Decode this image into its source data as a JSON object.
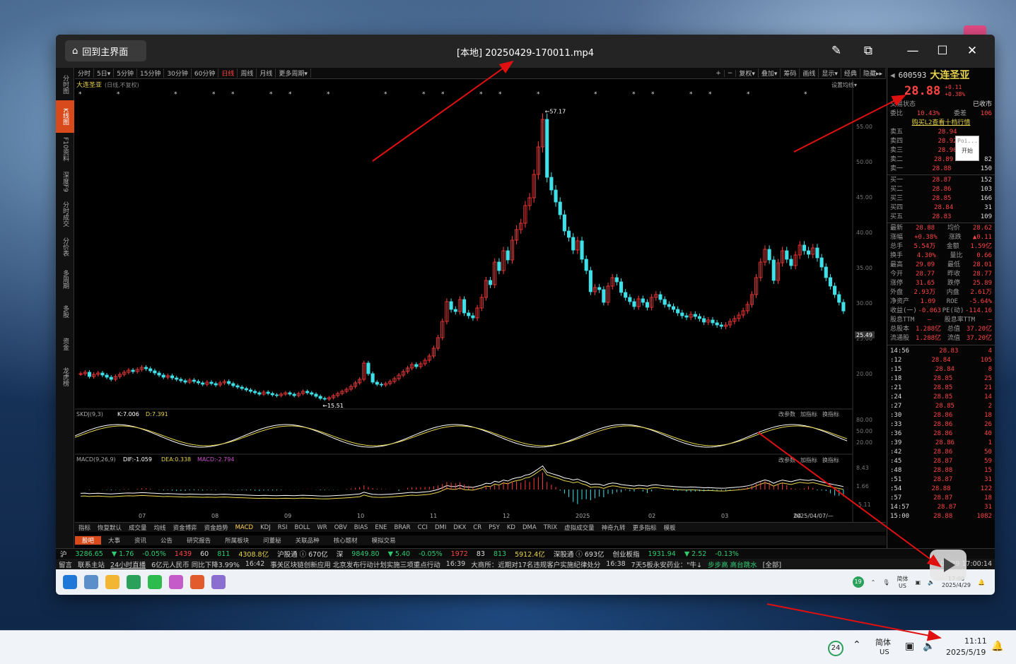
{
  "window": {
    "home_label": "回到主界面",
    "title": "[本地] 20250429-170011.mp4"
  },
  "period_tabs": [
    "分时",
    "5日▾",
    "5分钟",
    "15分钟",
    "30分钟",
    "60分钟",
    "日线",
    "周线",
    "月线",
    "更多周期▾"
  ],
  "period_active": "日线",
  "toolbar_right": [
    "+",
    "−",
    "复权▾",
    "叠加▾",
    "筹码",
    "画线",
    "显示▾",
    "经典",
    "隐藏▸▸"
  ],
  "left_tabs": [
    "分时图",
    "K线图",
    "F10资料",
    "深度F9",
    "分时成交",
    "分价表",
    "多周期",
    "多股",
    "资金",
    "龙虎榜"
  ],
  "chart_header": {
    "name": "大连圣亚",
    "mode": "(日线,不复权)",
    "right": "设置均线▾"
  },
  "chart_data": {
    "type": "candlestick",
    "price_axis": [
      "55.00",
      "50.00",
      "45.00",
      "40.00",
      "35.00",
      "30.00",
      "25.00",
      "20.00"
    ],
    "last_price_label": "25.49",
    "ylim": [
      15,
      58
    ],
    "high_label": "57.17",
    "low_label": "15.51",
    "x_ticks": [
      "07",
      "08",
      "09",
      "10",
      "11",
      "12",
      "2025",
      "02",
      "03",
      "04"
    ],
    "date_label": "2025/04/07/—",
    "closes": [
      20.0,
      20.2,
      19.6,
      19.9,
      20.1,
      19.8,
      19.5,
      19.2,
      19.6,
      19.9,
      20.2,
      20.5,
      20.3,
      20.6,
      20.9,
      20.7,
      20.4,
      20.1,
      19.8,
      19.5,
      19.7,
      19.4,
      19.2,
      19.0,
      18.8,
      19.1,
      18.9,
      18.7,
      18.5,
      18.8,
      18.6,
      18.4,
      18.7,
      18.9,
      18.6,
      18.3,
      18.1,
      17.9,
      17.7,
      17.5,
      17.3,
      17.1,
      17.4,
      17.2,
      17.0,
      16.9,
      17.1,
      17.3,
      17.1,
      16.9,
      17.2,
      17.5,
      17.3,
      17.1,
      16.8,
      16.5,
      16.4,
      16.6,
      16.9,
      17.2,
      17.5,
      17.8,
      18.2,
      18.7,
      19.2,
      21.5,
      20.0,
      18.8,
      18.5,
      18.4,
      18.6,
      18.9,
      19.3,
      19.8,
      20.3,
      20.8,
      21.3,
      21.0,
      21.4,
      21.9,
      22.5,
      23.6,
      25.1,
      27.4,
      30.2,
      29.1,
      28.8,
      30.5,
      28.6,
      28.2,
      27.9,
      29.3,
      30.8,
      33.2,
      32.6,
      35.8,
      34.6,
      37.4,
      36.1,
      38.9,
      40.4,
      41.3,
      43.8,
      44.9,
      48.2,
      52.1,
      56.0,
      47.8,
      46.0,
      44.3,
      42.5,
      40.2,
      39.3,
      37.5,
      38.8,
      36.2,
      34.6,
      31.6,
      32.2,
      31.9,
      30.1,
      32.4,
      33.6,
      33.0,
      31.5,
      30.8,
      30.2,
      29.5,
      30.6,
      30.1,
      29.4,
      30.8,
      31.2,
      30.5,
      29.8,
      29.5,
      29.1,
      28.6,
      28.2,
      28.0,
      28.4,
      28.1,
      27.8,
      27.3,
      27.6,
      27.2,
      26.9,
      26.7,
      26.9,
      27.4,
      27.8,
      28.3,
      28.9,
      29.8,
      31.2,
      33.6,
      35.8,
      37.6,
      36.1,
      33.2,
      35.7,
      37.4,
      36.2,
      35.3,
      36.8,
      38.2,
      37.4,
      36.9,
      37.8,
      36.4,
      35.1,
      33.6,
      32.4,
      31.2,
      30.1,
      28.88
    ],
    "kdj": {
      "label": "SKDJ(9,3)",
      "k": "K:7.006",
      "d": "D:7.391",
      "axis": [
        "80.00",
        "50.00",
        "20.00"
      ]
    },
    "macd": {
      "label": "MACD(9,26,9)",
      "dif": "DIF:-1.059",
      "dea": "DEA:0.338",
      "macd": "MACD:-2.794",
      "axis": [
        "8.43",
        "1.66",
        "-5.11"
      ]
    },
    "panel_buttons": [
      "改参数",
      "加指标",
      "换指标"
    ]
  },
  "indicator_tabs": [
    "指标",
    "恢复默认",
    "成交量",
    "均线",
    "资金博弈",
    "资金趋势",
    "MACD",
    "KDJ",
    "RSI",
    "BOLL",
    "WR",
    "OBV",
    "BIAS",
    "ENE",
    "BRAR",
    "CCI",
    "DMI",
    "DKX",
    "CR",
    "PSY",
    "KD",
    "DMA",
    "TRIX",
    "虚拟成交量",
    "神奇九转",
    "更多指标",
    "模板"
  ],
  "indicator_active": "MACD",
  "bottom_tabs": [
    "股吧",
    "大事",
    "资讯",
    "公告",
    "研究报告",
    "所属板块",
    "问董秘",
    "关联品种",
    "核心题材",
    "模拟交易"
  ],
  "quote": {
    "code": "600593",
    "name": "大连圣亚",
    "price": "28.88",
    "chg": "+0.11",
    "pct": "+0.38%",
    "status_label": "交易状态",
    "status": "已收市",
    "wb_label": "委比",
    "wb": "10.43%",
    "wc_label": "委差",
    "wc": "106",
    "link": "购买L2查看十档行情",
    "sells": [
      [
        "卖五",
        "28.94",
        ""
      ],
      [
        "卖四",
        "28.92",
        ""
      ],
      [
        "卖三",
        "28.90",
        ""
      ],
      [
        "卖二",
        "28.89",
        "82"
      ],
      [
        "卖一",
        "28.88",
        "150"
      ]
    ],
    "buys": [
      [
        "买一",
        "28.87",
        "152"
      ],
      [
        "买二",
        "28.86",
        "103"
      ],
      [
        "买三",
        "28.85",
        "166"
      ],
      [
        "买四",
        "28.84",
        "31"
      ],
      [
        "买五",
        "28.83",
        "109"
      ]
    ],
    "stats": [
      [
        "最新",
        "28.88",
        "均价",
        "28.62"
      ],
      [
        "涨幅",
        "+0.38%",
        "涨跌",
        "▲0.11"
      ],
      [
        "总手",
        "5.54万",
        "金额",
        "1.59亿"
      ],
      [
        "换手",
        "4.30%",
        "量比",
        "0.66"
      ],
      [
        "最高",
        "29.09",
        "最低",
        "28.01"
      ],
      [
        "今开",
        "28.77",
        "昨收",
        "28.77"
      ],
      [
        "涨停",
        "31.65",
        "跌停",
        "25.89"
      ],
      [
        "外盘",
        "2.93万",
        "内盘",
        "2.61万"
      ],
      [
        "净资产",
        "1.09",
        "ROE",
        "-5.64%"
      ],
      [
        "收益(一)",
        "-0.063",
        "PE(动)",
        "-114.16"
      ],
      [
        "股息TTM",
        "—",
        "股息率TTM",
        "—"
      ],
      [
        "总股本",
        "1.288亿",
        "总值",
        "37.20亿"
      ],
      [
        "流通股",
        "1.288亿",
        "流值",
        "37.20亿"
      ]
    ],
    "ticks": [
      [
        "14:56",
        "28.83",
        "4"
      ],
      [
        ":12",
        "28.84",
        "105"
      ],
      [
        ":15",
        "28.84",
        "8"
      ],
      [
        ":18",
        "28.85",
        "25"
      ],
      [
        ":21",
        "28.85",
        "21"
      ],
      [
        ":24",
        "28.85",
        "14"
      ],
      [
        ":27",
        "28.85",
        "2"
      ],
      [
        ":30",
        "28.86",
        "18"
      ],
      [
        ":33",
        "28.86",
        "26"
      ],
      [
        ":36",
        "28.86",
        "40"
      ],
      [
        ":39",
        "28.86",
        "1"
      ],
      [
        ":42",
        "28.86",
        "50"
      ],
      [
        ":45",
        "28.87",
        "59"
      ],
      [
        ":48",
        "28.88",
        "15"
      ],
      [
        ":51",
        "28.87",
        "31"
      ],
      [
        ":54",
        "28.88",
        "122"
      ],
      [
        ":57",
        "28.87",
        "18"
      ],
      [
        "14:57",
        "28.87",
        "31"
      ],
      [
        "15:00",
        "28.88",
        "1082"
      ]
    ],
    "popup": {
      "a": "Poi...",
      "b": "开始"
    }
  },
  "ticker": {
    "a": "沪",
    "b": "3286.65",
    "c": "▼ 1.76",
    "d": "-0.05%",
    "e": "1439",
    "f": "60",
    "g": "811",
    "h": "4308.8亿",
    "i": "沪股通 ⓘ 670亿",
    "j": "深",
    "k": "9849.80",
    "l": "▼ 5.40",
    "m": "-0.05%",
    "n": "1972",
    "o": "83",
    "p": "813",
    "q": "5912.4亿",
    "r": "深股通 ⓘ 693亿",
    "s": "创业板指",
    "t": "1931.94",
    "u": "▼ 2.52",
    "v": "-0.13%"
  },
  "news": {
    "a": "留言",
    "b": "联系主站",
    "c": "24小时直播",
    "d": "6亿元人民币  同比下降3.99%",
    "e": "16:42",
    "f": "事关区块链创新应用 北京发布行动计划实施三项重点行动",
    "g": "16:39",
    "h": "大商所：近期对17名违规客户实施纪律处分",
    "i": "16:38",
    "j": "7天5板永安药业：\"牛↓",
    "k": "步步高  高台跳水",
    "l": "[全部]",
    "m": "04/29 17:00:14"
  },
  "video_taskbar": {
    "lang": "简体",
    "region": "US",
    "time": "17:00",
    "date": "2025/4/29",
    "badge": "19"
  },
  "taskbar": {
    "badge": "24",
    "lang": "简体",
    "region": "US",
    "time": "11:11",
    "date": "2025/5/19"
  }
}
